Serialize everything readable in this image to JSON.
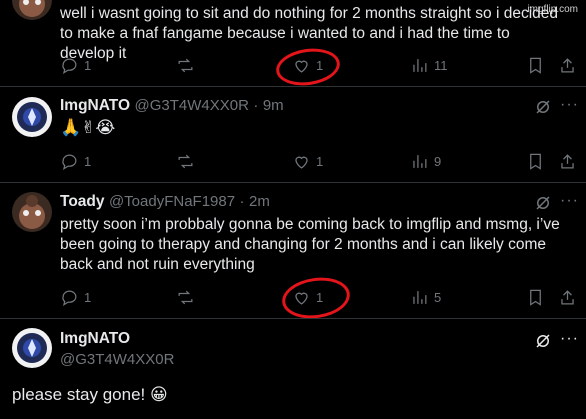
{
  "watermark": "imgflip.com",
  "posts": [
    {
      "text": "well i wasnt going to sit and do nothing for 2 months straight so i decided to make a fnaf fangame because i wanted to and i had the time to develop it",
      "replies": "1",
      "likes": "1",
      "views": "11"
    },
    {
      "name": "ImgNATO",
      "handle": "@G3T4W4XX0R",
      "sep": "·",
      "time": "9m",
      "text": "🙏✌😭",
      "replies": "1",
      "likes": "1",
      "views": "9"
    },
    {
      "name": "Toady",
      "handle": "@ToadyFNaF1987",
      "sep": "·",
      "time": "2m",
      "text": "pretty soon i’m probbaly gonna be coming back to imgflip and msmg, i’ve been going to therapy and changing for 2 months and i can likely come back and not ruin everything",
      "replies": "1",
      "likes": "1",
      "views": "5"
    },
    {
      "name": "ImgNATO",
      "handle": "@G3T4W4XX0R",
      "text": "please stay gone! 😀"
    }
  ],
  "more_label": "···",
  "colors": {
    "annotation": "#e3141a",
    "accent": "#1d9bf0",
    "muted": "#71767b"
  }
}
